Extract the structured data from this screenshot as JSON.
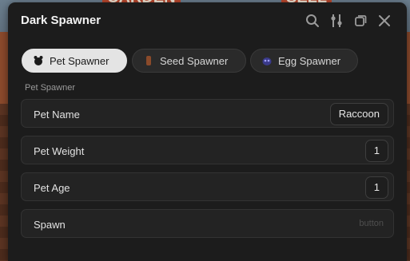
{
  "background": {
    "sign_left": "CARDEN",
    "sign_right": "SELL"
  },
  "window": {
    "title": "Dark Spawner",
    "icons": [
      "search-icon",
      "sliders-icon",
      "minimize-window-icon",
      "close-icon"
    ]
  },
  "tabs": [
    {
      "label": "Pet Spawner",
      "active": true
    },
    {
      "label": "Seed Spawner",
      "active": false
    },
    {
      "label": "Egg Spawner",
      "active": false
    }
  ],
  "section": {
    "label": "Pet Spawner"
  },
  "fields": {
    "pet_name": {
      "label": "Pet Name",
      "value": "Raccoon"
    },
    "pet_weight": {
      "label": "Pet Weight",
      "value": "1"
    },
    "pet_age": {
      "label": "Pet Age",
      "value": "1"
    },
    "spawn": {
      "label": "Spawn",
      "hint": "button"
    }
  },
  "colors": {
    "window_bg": "#1c1c1c",
    "active_tab": "#e4e4e4",
    "row_bg": "#232323"
  }
}
